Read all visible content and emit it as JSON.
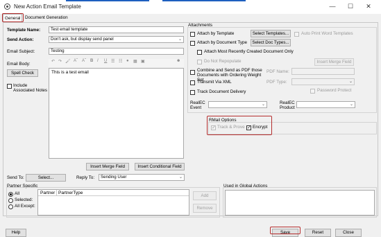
{
  "window": {
    "title": "New Action Email Template",
    "minimize": "—",
    "maximize": "☐",
    "close": "✕"
  },
  "tabs": [
    {
      "label": "General"
    },
    {
      "label": "Document Generation"
    }
  ],
  "form": {
    "template_name_label": "Template Name:",
    "template_name_value": "Test email template",
    "send_action_label": "Send Action:",
    "send_action_value": "Don't ask, but display send panel",
    "email_subject_label": "Email Subject:",
    "email_subject_value": "Testing",
    "email_body_label": "Email Body:",
    "email_body_value": "This is a test email",
    "spell_check": "Spell Check",
    "include_notes": "Include Associated Notes",
    "insert_merge_field": "Insert Merge Field",
    "insert_conditional_field": "Insert Conditional Field"
  },
  "attachments": {
    "title": "Attachments",
    "attach_by_template": "Attach by Template",
    "select_templates": "Select Templates...",
    "auto_print": "Auto Print Word Templates",
    "attach_by_doc_type": "Attach by Document Type",
    "select_doc_types": "Select Doc Types...",
    "attach_most_recent": "Attach Most Recently Created Document Only",
    "do_not_repopulate": "Do Not Repopulate",
    "insert_merge_field": "Insert Merge Field",
    "combine_pdf": "Combine and Send as PDF those Documents with Ordering Weight Set",
    "pdf_name_label": "PDF Name:",
    "transmit_xml": "Transmit Via XML",
    "pdf_type_label": "PDF Type:",
    "password_protect": "Password Protect",
    "track_delivery": "Track Document Delivery",
    "realec_event_label": "RealEC Event",
    "realec_product_label": "RealEC Product"
  },
  "rmail": {
    "title": "RMail Options",
    "track_prove": "Track & Prove",
    "encrypt": "Encrypt"
  },
  "send": {
    "send_to_label": "Send To:",
    "select_button": "Select...",
    "reply_to_label": "Reply To:",
    "reply_to_value": "Sending User"
  },
  "partner": {
    "title": "Partner Specific",
    "options": [
      "All",
      "Selected:",
      "All Except:"
    ],
    "columns": [
      "Partner",
      "PartnerType"
    ],
    "add": "Add",
    "remove": "Remove",
    "global_actions_title": "Used in Global Actions"
  },
  "footer": {
    "help": "Help",
    "save": "Save",
    "reset": "Reset",
    "close": "Close"
  }
}
